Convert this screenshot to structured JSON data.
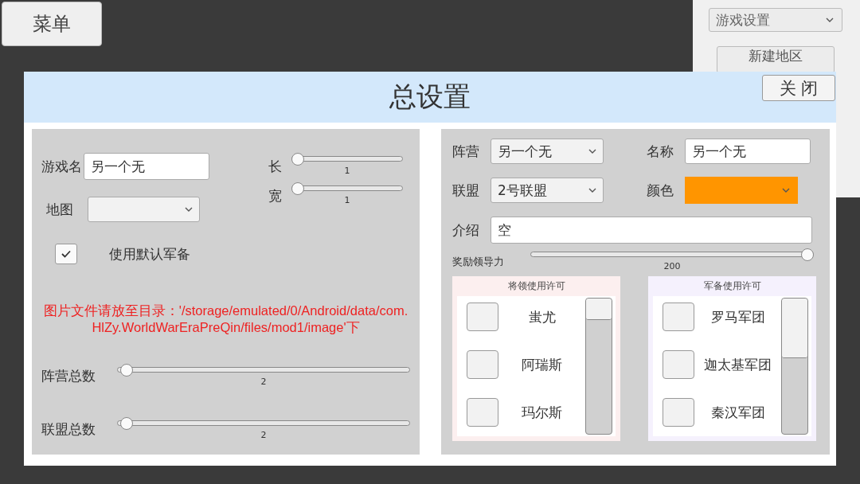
{
  "menu_button": "菜单",
  "side_panel": {
    "dropdown": "游戏设置",
    "button": "新建地区"
  },
  "dialog": {
    "title": "总设置",
    "close_button": "关 闭",
    "game": {
      "name_label": "游戏名",
      "name_value": "另一个无",
      "length": {
        "label": "长",
        "level": 0,
        "reading": "1"
      },
      "width": {
        "label": "宽",
        "level": 0,
        "reading": "1"
      },
      "map_label": "地图",
      "use_default": {
        "label": "使用默认军备",
        "checked": true
      },
      "notice": "图片文件请放至目录：'/storage/emulated/0/Android/data/com.HlZy.WorldWarEraPreQin/files/mod1/image'下",
      "faction_count": {
        "label": "阵营总数",
        "level": 0.01,
        "reading": "2"
      },
      "alliance_count": {
        "label": "联盟总数",
        "level": 0.01,
        "reading": "2"
      }
    },
    "faction": {
      "faction_label": "阵营",
      "faction_value": "另一个无",
      "name_label": "名称",
      "name_value": "另一个无",
      "alliance_label": "联盟",
      "alliance_value": "2号联盟",
      "color_label": "颜色",
      "color": "#ff9500",
      "intro_label": "介绍",
      "intro_value": "空",
      "leadership": {
        "label": "奖励领导力",
        "level": 1,
        "reading": "200"
      },
      "lists": [
        {
          "title": "将领使用许可",
          "color": "#fcefef",
          "items": [
            {
              "name": "蚩尤",
              "checked": false
            },
            {
              "name": "阿瑞斯",
              "checked": false
            },
            {
              "name": "玛尔斯",
              "checked": false
            }
          ]
        },
        {
          "title": "军备使用许可",
          "color": "#f5f1fd",
          "items": [
            {
              "name": "罗马军团",
              "checked": false
            },
            {
              "name": "迦太基军团",
              "checked": false
            },
            {
              "name": "秦汉军团",
              "checked": false
            }
          ]
        }
      ]
    }
  }
}
